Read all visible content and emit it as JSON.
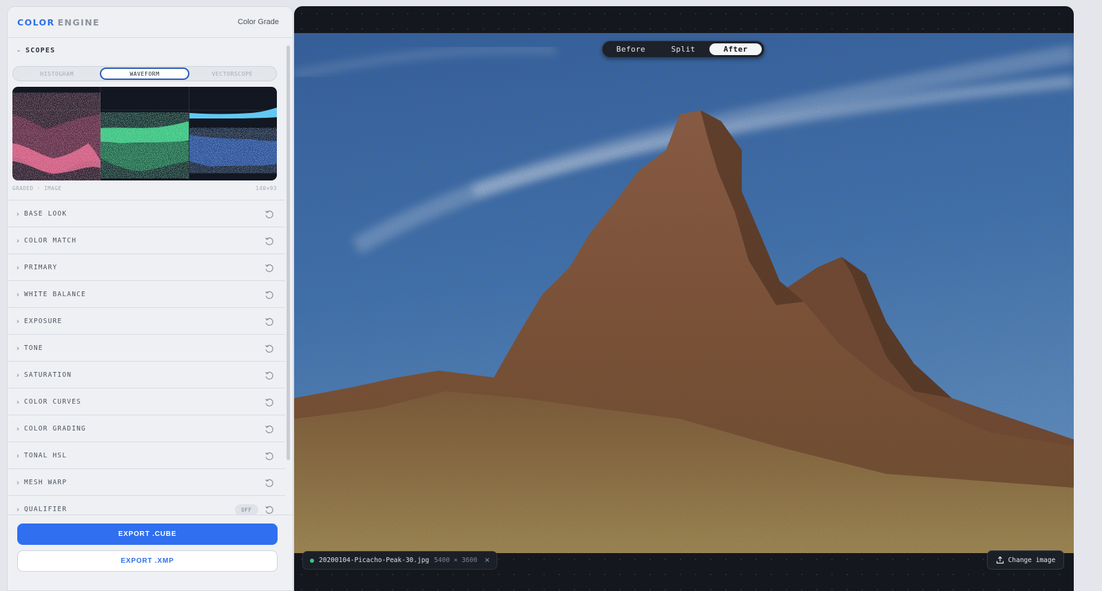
{
  "app": {
    "brand_primary": "COLOR",
    "brand_secondary": "ENGINE",
    "mode": "Color Grade"
  },
  "scopes": {
    "title": "SCOPES",
    "tabs": [
      {
        "label": "HISTOGRAM",
        "active": false
      },
      {
        "label": "WAVEFORM",
        "active": true
      },
      {
        "label": "VECTORSCOPE",
        "active": false
      }
    ],
    "footer_left": "GRADED · IMAGE",
    "footer_right": "140×93"
  },
  "sections": [
    {
      "label": "BASE LOOK"
    },
    {
      "label": "COLOR MATCH"
    },
    {
      "label": "PRIMARY"
    },
    {
      "label": "WHITE BALANCE"
    },
    {
      "label": "EXPOSURE"
    },
    {
      "label": "TONE"
    },
    {
      "label": "SATURATION"
    },
    {
      "label": "COLOR CURVES"
    },
    {
      "label": "COLOR GRADING"
    },
    {
      "label": "TONAL HSL"
    },
    {
      "label": "MESH WARP"
    },
    {
      "label": "QUALIFIER",
      "badge": "OFF"
    }
  ],
  "export": {
    "cube_label": "EXPORT .CUBE",
    "xmp_label": "EXPORT .XMP"
  },
  "viewer": {
    "compare_options": [
      {
        "label": "Before",
        "active": false
      },
      {
        "label": "Split",
        "active": false
      },
      {
        "label": "After",
        "active": true
      }
    ],
    "file": {
      "name": "20200104-Picacho-Peak-30.jpg",
      "dimensions": "5400 × 3600",
      "close_symbol": "×"
    },
    "change_image_label": "Change image"
  },
  "colors": {
    "accent": "#2f6ff0",
    "status_dot": "#35c884",
    "viewer_bg": "#14171d"
  },
  "icons": {
    "reset": "reset-icon",
    "upload": "upload-icon",
    "chevron": "chevron-right-icon"
  }
}
